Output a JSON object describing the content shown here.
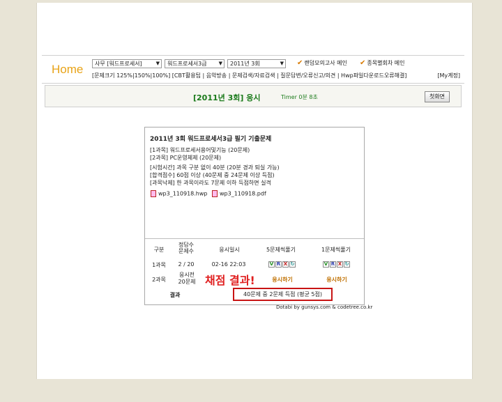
{
  "header": {
    "home_label": "Home",
    "selects": [
      "사무 [워드프로세서]",
      "워드프로세서3급",
      "2011년 3회"
    ],
    "checks": [
      "랜덤모의고사 메인",
      "종목별회차 메인"
    ],
    "menu": "[문제크기 125%|150%|100%] [CBT활용팁 | 음악방송 | 문제검색/자료검색 | 질문답변/오류신고/의견 | Hwp파일다운로드오류해결]",
    "my_account": "[My계정]"
  },
  "exam": {
    "title": "[2011년 3회] 응시",
    "timer": "Timer   0분   8초",
    "first_screen": "첫화면"
  },
  "card": {
    "title": "2011년 3회 워드프로세서3급 필기 기출문제",
    "subjects": [
      "[1과목] 워드프로세서용어및기능 (20문제)",
      "[2과목] PC운영체제 (20문제)"
    ],
    "rules": [
      "[시험시간] 과목 구분 없이 40분 (20분 경과 퇴실 가능)",
      "[합격점수] 60점 이상 (40문제 중 24문제 이상 득점)",
      "[과목낙제] 한 과목이라도 7문제 이하 득점하면 실격"
    ],
    "files": [
      "wp3_110918.hwp",
      "wp3_110918.pdf"
    ]
  },
  "table": {
    "headers": [
      "구분",
      "정답수\n문제수",
      "응시일시",
      "5문제씩풀기",
      "1문제씩풀기"
    ],
    "row1": {
      "label": "1과목",
      "score": "2 / 20",
      "date": "02-16 22:03"
    },
    "row2": {
      "label": "2과목",
      "status": "응시전\n20문제",
      "take1": "응시하기",
      "take2": "응시하기"
    },
    "result_label": "결과",
    "grade_text": "채점 결과!",
    "result": "40문제 중 2문제 득점  (평균 5점)"
  },
  "buttons": {
    "v": "V",
    "r": "R",
    "x": "X",
    "c": "↻"
  },
  "credit": "Dotabi by gunsys.com & codetree.co.kr"
}
